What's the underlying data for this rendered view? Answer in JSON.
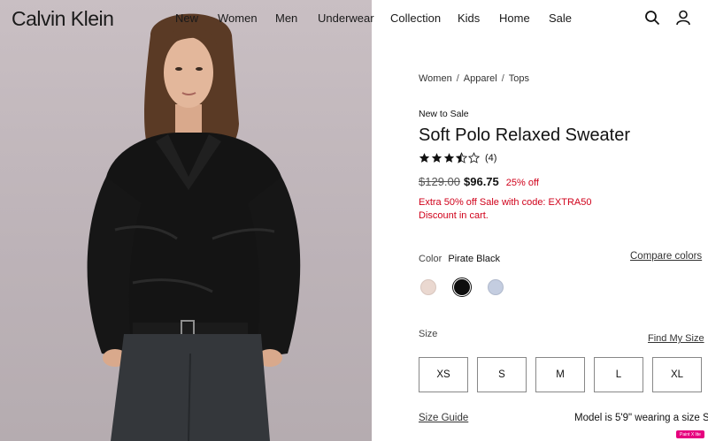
{
  "brand": {
    "logo_text": "Calvin Klein"
  },
  "nav": {
    "items": [
      {
        "label": "New"
      },
      {
        "label": "Women"
      },
      {
        "label": "Men"
      },
      {
        "label": "Underwear"
      },
      {
        "label": "Collection"
      },
      {
        "label": "Kids"
      },
      {
        "label": "Home"
      },
      {
        "label": "Sale"
      }
    ],
    "icons": [
      "search-icon",
      "account-icon"
    ]
  },
  "breadcrumb": [
    "Women",
    "Apparel",
    "Tops"
  ],
  "product": {
    "tag": "New to Sale",
    "title": "Soft Polo Relaxed Sweater",
    "rating": {
      "value": 3.5,
      "max": 5,
      "count_text": "(4)"
    },
    "price": {
      "original": "$129.00",
      "sale": "$96.75",
      "discount": "25% off"
    },
    "promo": "Extra 50% off Sale with code: EXTRA50 Discount in cart.",
    "color": {
      "label": "Color",
      "selected": "Pirate Black",
      "compare_link": "Compare colors",
      "swatches": [
        {
          "name": "beige",
          "hex": "#ead8d0",
          "selected": false
        },
        {
          "name": "black",
          "hex": "#0d0d0d",
          "selected": true
        },
        {
          "name": "light-blue",
          "hex": "#c4cde0",
          "selected": false
        }
      ]
    },
    "size": {
      "label": "Size",
      "find_link": "Find My Size",
      "options": [
        "XS",
        "S",
        "M",
        "L",
        "XL"
      ],
      "guide_link": "Size Guide",
      "model_info": "Model is 5'9\" wearing a size S"
    }
  },
  "badge": {
    "text": "Paint X lite"
  },
  "colors": {
    "sale_red": "#d0021b",
    "hero_bg": "#c2b8bd"
  }
}
